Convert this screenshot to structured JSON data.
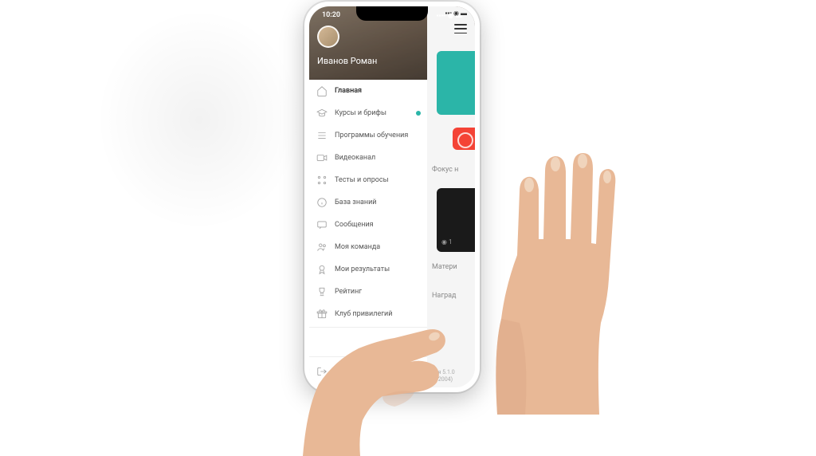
{
  "status_bar": {
    "time": "10:20"
  },
  "user": {
    "name": "Иванов Роман"
  },
  "menu": {
    "items": [
      {
        "label": "Главная",
        "active": true
      },
      {
        "label": "Курсы и брифы",
        "badge": true
      },
      {
        "label": "Программы обучения"
      },
      {
        "label": "Видеоканал"
      },
      {
        "label": "Тесты и опросы"
      },
      {
        "label": "База знаний"
      },
      {
        "label": "Сообщения"
      },
      {
        "label": "Моя команда"
      },
      {
        "label": "Мои результаты"
      },
      {
        "label": "Рейтинг"
      },
      {
        "label": "Клуб привилегий"
      }
    ],
    "logout": "Выйти"
  },
  "content": {
    "section1": "Фокус н",
    "section2": "Матери",
    "section3": "Наград"
  },
  "version": {
    "line1": "зия 5.1.0",
    "line2": "502004)"
  }
}
